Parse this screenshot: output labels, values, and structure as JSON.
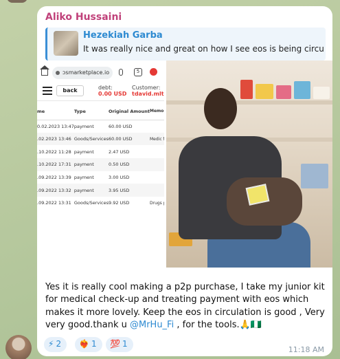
{
  "message": {
    "sender": "Aliko Hussaini",
    "reply": {
      "author": "Hezekiah Garba",
      "text": "It was really nice and great on how I see eos is being circul..."
    },
    "caption_before": "Yes  it is really cool making a p2p purchase, I take my junior kit for medical check-up and treating payment with eos which makes it more lovely. Keep the eos in circulation is good , Very very good.thank u ",
    "mention": "@MrHu_Fi",
    "caption_after": " , for the tools.🙏🇳🇬",
    "time": "11:18 AM",
    "reactions": [
      {
        "emoji": "⚡",
        "count": "2"
      },
      {
        "emoji": "❤️‍🔥",
        "count": "1"
      },
      {
        "emoji": "💯",
        "count": "1"
      }
    ]
  },
  "screenshot": {
    "url": "ɔsmarketplace.io",
    "tabs_count": "5",
    "back_label": "back",
    "debt_label": "debt:",
    "debt_value": "0.00 USD",
    "customer_label": "Customer:",
    "customer_value": "tdavid.mlt",
    "columns": [
      "me",
      "Type",
      "Original Amount",
      "Memo"
    ],
    "rows": [
      [
        "0.02.2023 13:47",
        "payment",
        "60.00 USD",
        ""
      ],
      [
        ".02.2023 13:46",
        "Goods/Services",
        "60.00 USD",
        "Medic fever"
      ],
      [
        ".10.2022 11:28",
        "payment",
        "2.47 USD",
        ""
      ],
      [
        ".10.2022 17:31",
        "payment",
        "0.50 USD",
        ""
      ],
      [
        ".09.2022 13:39",
        "payment",
        "3.00 USD",
        ""
      ],
      [
        ".09.2022 13:32",
        "payment",
        "3.95 USD",
        ""
      ],
      [
        ".09.2022 13:31",
        "Goods/Services",
        "9.92 USD",
        "Drugs peptic"
      ]
    ]
  }
}
